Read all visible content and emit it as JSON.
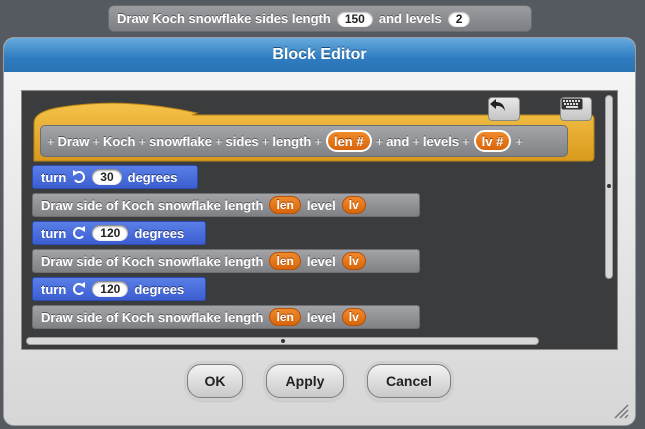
{
  "top_block": {
    "prefix": "Draw Koch snowflake sides length",
    "length_value": "150",
    "middle": "and levels",
    "levels_value": "2"
  },
  "dialog": {
    "title": "Block Editor"
  },
  "hat": {
    "words": [
      "Draw",
      "Koch",
      "snowflake",
      "sides",
      "length"
    ],
    "param1": "len #",
    "and_word": "and",
    "levels_word": "levels",
    "param2": "lv #",
    "undo_icon": "undo-icon",
    "keyboard_icon": "keyboard-icon"
  },
  "script": [
    {
      "type": "turn",
      "direction": "left",
      "label": "turn",
      "value": "30",
      "suffix": "degrees"
    },
    {
      "type": "draw",
      "text": "Draw side of Koch snowflake length",
      "param1": "len",
      "mid": "level",
      "param2": "lv"
    },
    {
      "type": "turn",
      "direction": "right",
      "label": "turn",
      "value": "120",
      "suffix": "degrees"
    },
    {
      "type": "draw",
      "text": "Draw side of Koch snowflake length",
      "param1": "len",
      "mid": "level",
      "param2": "lv"
    },
    {
      "type": "turn",
      "direction": "right",
      "label": "turn",
      "value": "120",
      "suffix": "degrees"
    },
    {
      "type": "draw",
      "text": "Draw side of Koch snowflake length",
      "param1": "len",
      "mid": "level",
      "param2": "lv"
    }
  ],
  "buttons": {
    "ok": "OK",
    "apply": "Apply",
    "cancel": "Cancel"
  },
  "colors": {
    "motion_blue": "#4a6cd4",
    "custom_gray": "#8e9094",
    "variable_orange": "#e8771a",
    "hat_gold": "#e6a82e",
    "title_blue": "#2f7cc1"
  }
}
